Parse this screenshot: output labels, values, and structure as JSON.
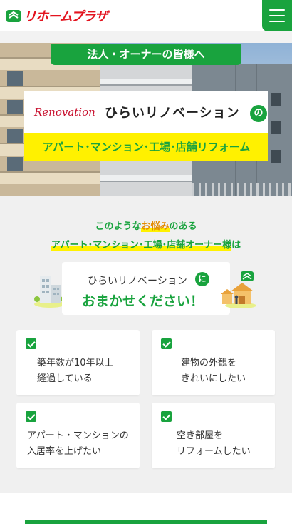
{
  "header": {
    "logo_text": "リホームプラザ",
    "menu_icon": "hamburger-icon",
    "brand_color": "#19a33e",
    "logo_color": "#e3141f"
  },
  "hero": {
    "banner": "法人・オーナーの皆様へ",
    "renovation_script": "Renovation",
    "company_name": "ひらいリノベーション",
    "particle": "の",
    "services": "アパート･マンション･工場･店舗リフォーム",
    "accent_yellow": "#fff100"
  },
  "concern": {
    "line1_pre": "このような",
    "line1_em": "お悩み",
    "line1_post": "のある",
    "line2_hl": "アパート･マンション･工場･店舗オーナー様",
    "line2_post": "は",
    "msg_line1": "ひらいリノベーション",
    "msg_particle": "に",
    "msg_line2": "おまかせください！"
  },
  "cards": [
    {
      "line1": "築年数が10年以上",
      "line2": "経過している"
    },
    {
      "line1": "建物の外観を",
      "line2": "きれいにしたい"
    },
    {
      "line1": "アパート・マンションの",
      "line2": "入居率を上げたい"
    },
    {
      "line1": "空き部屋を",
      "line2": "リフォームしたい"
    }
  ]
}
